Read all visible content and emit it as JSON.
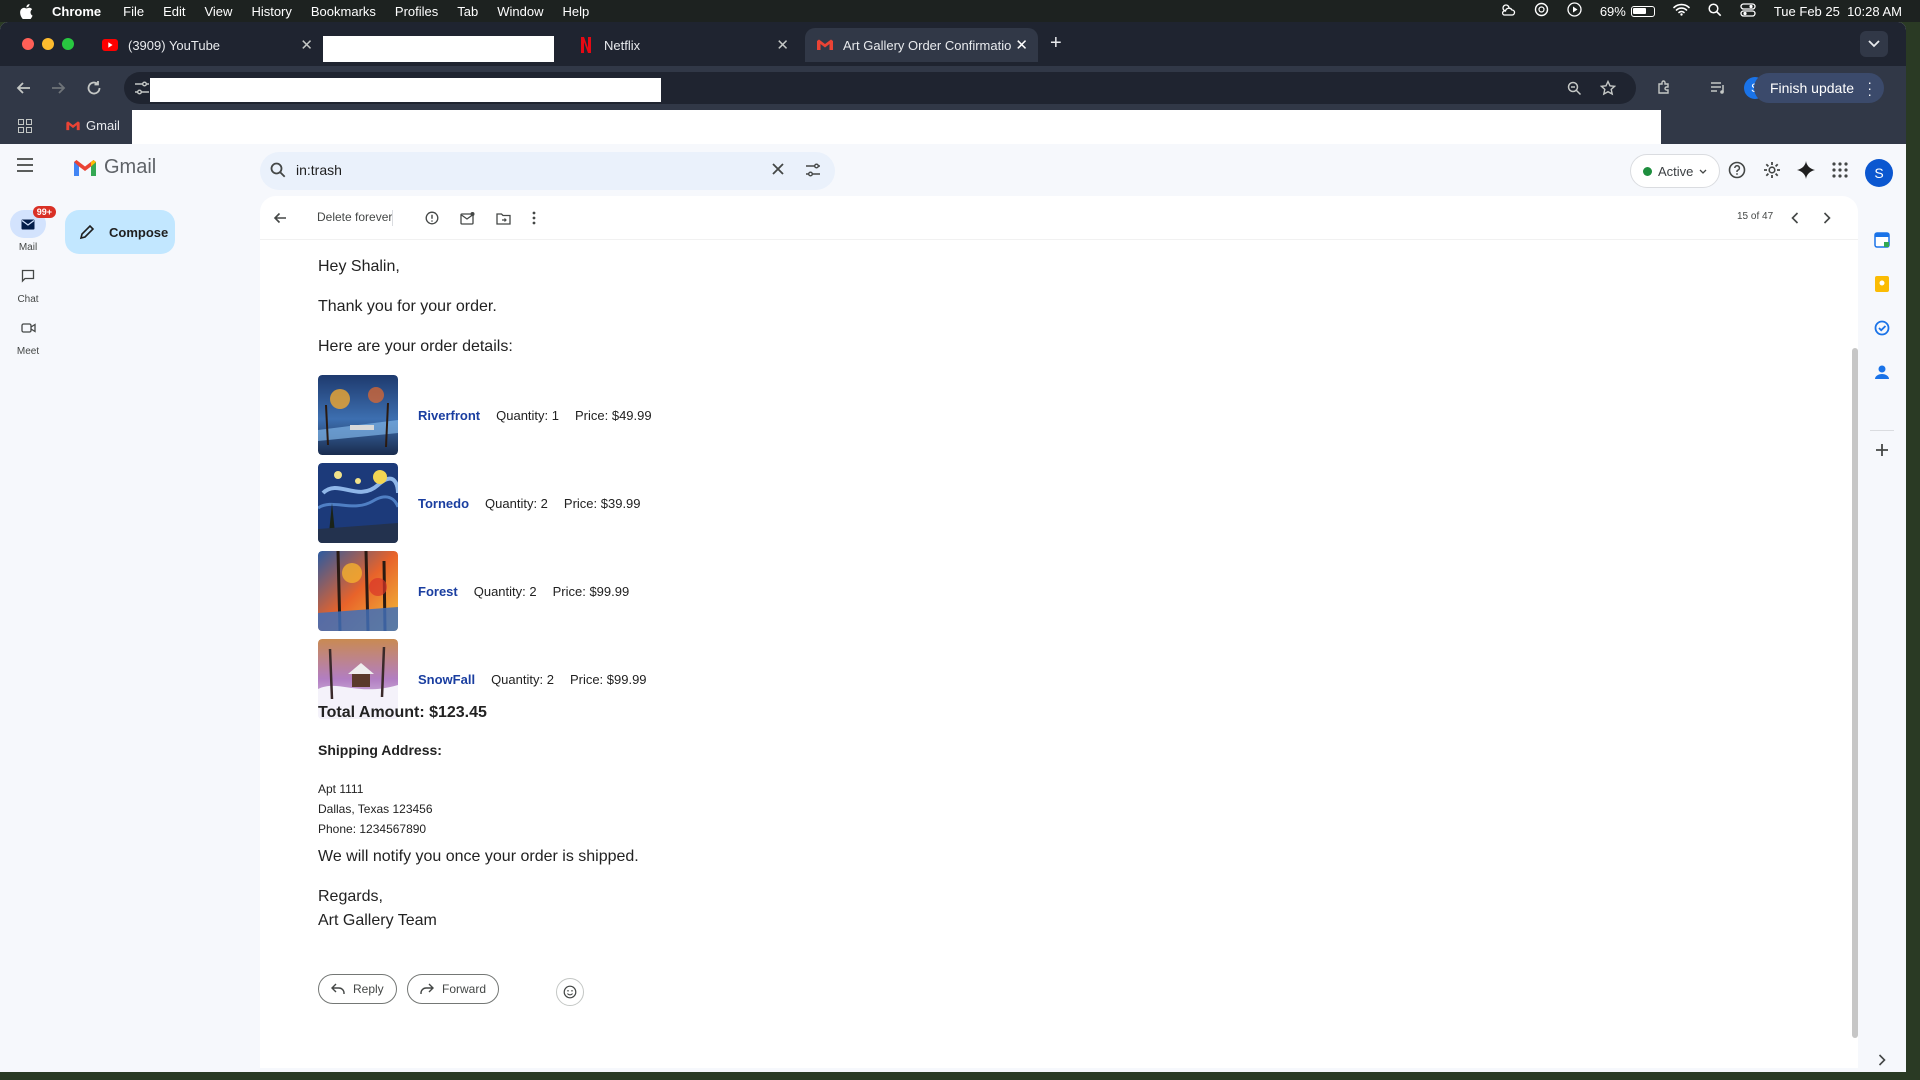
{
  "menubar": {
    "app": "Chrome",
    "items": [
      "File",
      "Edit",
      "View",
      "History",
      "Bookmarks",
      "Profiles",
      "Tab",
      "Window",
      "Help"
    ],
    "battery": "69%",
    "datetime": "Tue Feb 25  10:28 AM"
  },
  "tabs": [
    {
      "title": "(3909) YouTube"
    },
    {
      "title": ""
    },
    {
      "title": "Netflix"
    },
    {
      "title": "Art Gallery Order Confirmatio"
    }
  ],
  "toolbar": {
    "profile_initial": "S",
    "finish_update": "Finish update"
  },
  "bookmarks": {
    "gmail": "Gmail"
  },
  "gmail": {
    "logo_text": "Gmail",
    "search_query": "in:trash",
    "status": "Active",
    "account_initial": "S",
    "rail": {
      "mail": "Mail",
      "mail_badge": "99+",
      "chat": "Chat",
      "meet": "Meet"
    },
    "compose": "Compose",
    "mail_toolbar": {
      "delete_forever": "Delete forever",
      "count": "15 of 47"
    }
  },
  "email": {
    "greeting": "Hey Shalin,",
    "thanks": "Thank you for your order.",
    "details_intro": "Here are your order details:",
    "items": [
      {
        "name": "Riverfront",
        "quantity": "Quantity: 1",
        "price": "Price: $49.99"
      },
      {
        "name": "Tornedo",
        "quantity": "Quantity: 2",
        "price": "Price: $39.99"
      },
      {
        "name": "Forest",
        "quantity": "Quantity: 2",
        "price": "Price: $99.99"
      },
      {
        "name": "SnowFall",
        "quantity": "Quantity: 2",
        "price": "Price: $99.99"
      }
    ],
    "total": "Total Amount: $123.45",
    "shipping_label": "Shipping Address:",
    "address_line1": "Apt 1111",
    "address_line2": "Dallas, Texas 123456",
    "phone": "Phone: 1234567890",
    "notify": "We will notify you once your order is shipped.",
    "regards": "Regards,",
    "signature": "Art Gallery Team",
    "reply": "Reply",
    "forward": "Forward"
  },
  "colors": {
    "accent": "#0b57d0",
    "compose": "#c2e7ff",
    "link": "#1a3ea0",
    "active": "#1e8e3e",
    "badge": "#d93025"
  }
}
